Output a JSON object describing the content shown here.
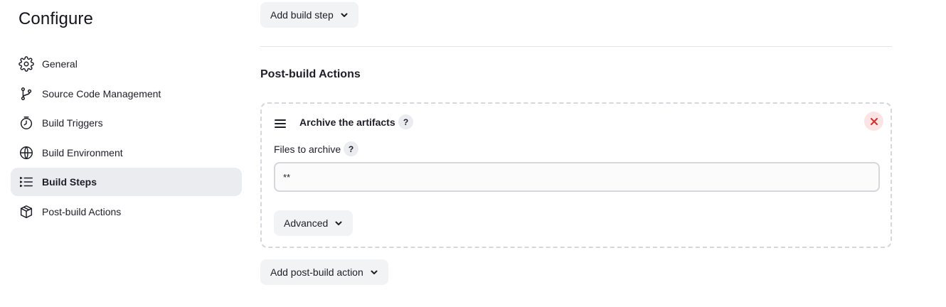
{
  "page": {
    "title": "Configure"
  },
  "sidebar": {
    "items": [
      {
        "label": "General",
        "icon": "gear-icon"
      },
      {
        "label": "Source Code Management",
        "icon": "git-branch-icon"
      },
      {
        "label": "Build Triggers",
        "icon": "timer-icon"
      },
      {
        "label": "Build Environment",
        "icon": "globe-icon"
      },
      {
        "label": "Build Steps",
        "icon": "list-icon",
        "active": true
      },
      {
        "label": "Post-build Actions",
        "icon": "package-icon"
      }
    ]
  },
  "build_steps": {
    "add_button": "Add build step"
  },
  "post_build": {
    "section_title": "Post-build Actions",
    "card": {
      "title": "Archive the artifacts",
      "help": "?",
      "field_label": "Files to archive",
      "field_value": "**",
      "advanced_button": "Advanced"
    },
    "add_button": "Add post-build action"
  },
  "colors": {
    "active_bg": "#ebecf0",
    "close_bg": "#fde4e4",
    "close_icon": "#d12f2f"
  }
}
